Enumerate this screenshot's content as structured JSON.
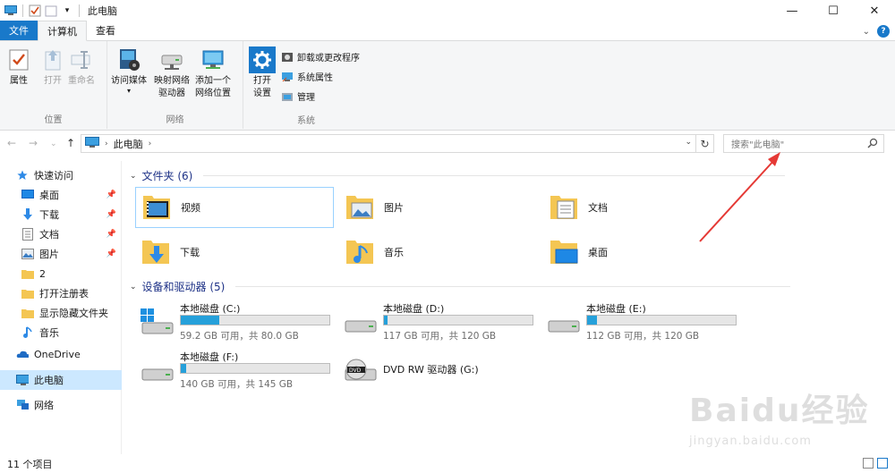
{
  "window": {
    "title": "此电脑",
    "controls": {
      "minimize": "—",
      "maximize": "☐",
      "close": "✕"
    }
  },
  "ribbon_tabs": {
    "file": "文件",
    "computer": "计算机",
    "view": "查看"
  },
  "ribbon": {
    "location": {
      "label": "位置",
      "properties": "属性",
      "open": "打开",
      "rename": "重命名"
    },
    "network": {
      "label": "网络",
      "access_media": "访问媒体",
      "map_drive_l1": "映射网络",
      "map_drive_l2": "驱动器",
      "add_location_l1": "添加一个",
      "add_location_l2": "网络位置"
    },
    "system": {
      "label": "系统",
      "open_settings_l1": "打开",
      "open_settings_l2": "设置",
      "uninstall": "卸载或更改程序",
      "system_properties": "系统属性",
      "manage": "管理"
    }
  },
  "address_bar": {
    "path": "此电脑",
    "search_placeholder": "搜索\"此电脑\""
  },
  "nav_pane": {
    "quick_access": "快速访问",
    "items": [
      {
        "label": "桌面",
        "pinned": true
      },
      {
        "label": "下载",
        "pinned": true
      },
      {
        "label": "文档",
        "pinned": true
      },
      {
        "label": "图片",
        "pinned": true
      },
      {
        "label": "2",
        "pinned": false
      },
      {
        "label": "打开注册表",
        "pinned": false
      },
      {
        "label": "显示隐藏文件夹",
        "pinned": false
      },
      {
        "label": "音乐",
        "pinned": false
      }
    ],
    "onedrive": "OneDrive",
    "this_pc": "此电脑",
    "network": "网络"
  },
  "content": {
    "folders_header": "文件夹 (6)",
    "folders": [
      "视频",
      "图片",
      "文档",
      "下载",
      "音乐",
      "桌面"
    ],
    "drives_header": "设备和驱动器 (5)",
    "drives": [
      {
        "name": "本地磁盘 (C:)",
        "info": "59.2 GB 可用，共 80.0 GB",
        "used_fraction": 0.26
      },
      {
        "name": "本地磁盘 (D:)",
        "info": "117 GB 可用，共 120 GB",
        "used_fraction": 0.025
      },
      {
        "name": "本地磁盘 (E:)",
        "info": "112 GB 可用，共 120 GB",
        "used_fraction": 0.067
      },
      {
        "name": "本地磁盘 (F:)",
        "info": "140 GB 可用，共 145 GB",
        "used_fraction": 0.034
      },
      {
        "name": "DVD RW 驱动器 (G:)"
      }
    ]
  },
  "status_bar": {
    "item_count": "11 个项目"
  },
  "watermark": {
    "brand": "Baidu经验",
    "url": "jingyan.baidu.com"
  },
  "colors": {
    "accent": "#1979ca",
    "selection": "#cce8ff",
    "drive_fill": "#26a0da",
    "annotation_arrow": "#e53935",
    "folder_yellow": "#f4c653"
  }
}
